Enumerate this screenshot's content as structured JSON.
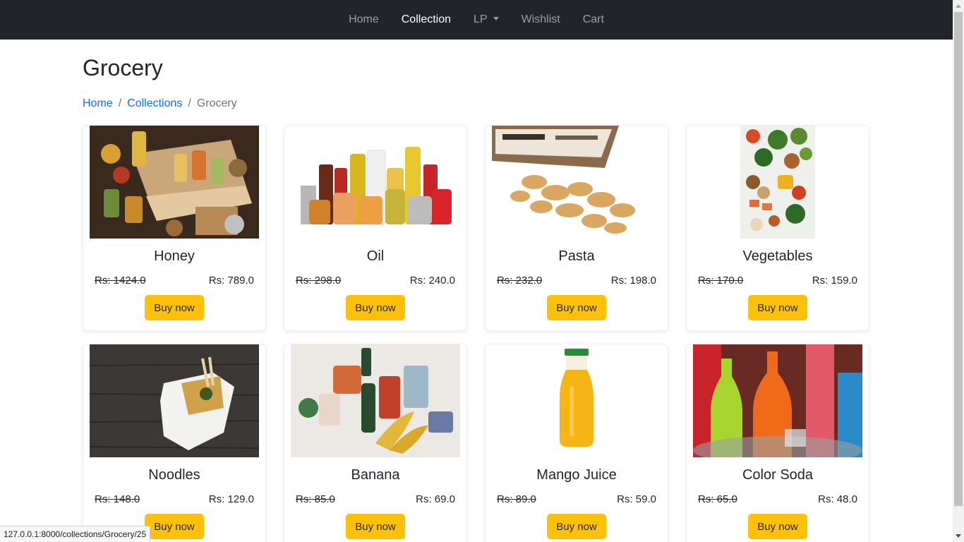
{
  "nav": {
    "items": [
      {
        "label": "Home",
        "active": false
      },
      {
        "label": "Collection",
        "active": true
      },
      {
        "label": "LP",
        "dropdown": true
      },
      {
        "label": "Wishlist",
        "active": false
      },
      {
        "label": "Cart",
        "active": false
      }
    ]
  },
  "page": {
    "title": "Grocery"
  },
  "breadcrumb": {
    "home": "Home",
    "collections": "Collections",
    "current": "Grocery"
  },
  "buy_label": "Buy now",
  "products": [
    {
      "name": "Honey",
      "old_price": "Rs: 1424.0",
      "price": "Rs: 789.0"
    },
    {
      "name": "Oil",
      "old_price": "Rs: 298.0",
      "price": "Rs: 240.0"
    },
    {
      "name": "Pasta",
      "old_price": "Rs: 232.0",
      "price": "Rs: 198.0"
    },
    {
      "name": "Vegetables",
      "old_price": "Rs: 170.0",
      "price": "Rs: 159.0"
    },
    {
      "name": "Noodles",
      "old_price": "Rs: 148.0",
      "price": "Rs: 129.0"
    },
    {
      "name": "Banana",
      "old_price": "Rs: 85.0",
      "price": "Rs: 69.0"
    },
    {
      "name": "Mango Juice",
      "old_price": "Rs: 89.0",
      "price": "Rs: 59.0"
    },
    {
      "name": "Color Soda",
      "old_price": "Rs: 65.0",
      "price": "Rs: 48.0"
    }
  ],
  "status_bar": {
    "url": "127.0.0.1:8000/collections/Grocery/25"
  },
  "colors": {
    "navbar": "#212529",
    "button": "#ffc107",
    "link": "#0d6efd"
  }
}
